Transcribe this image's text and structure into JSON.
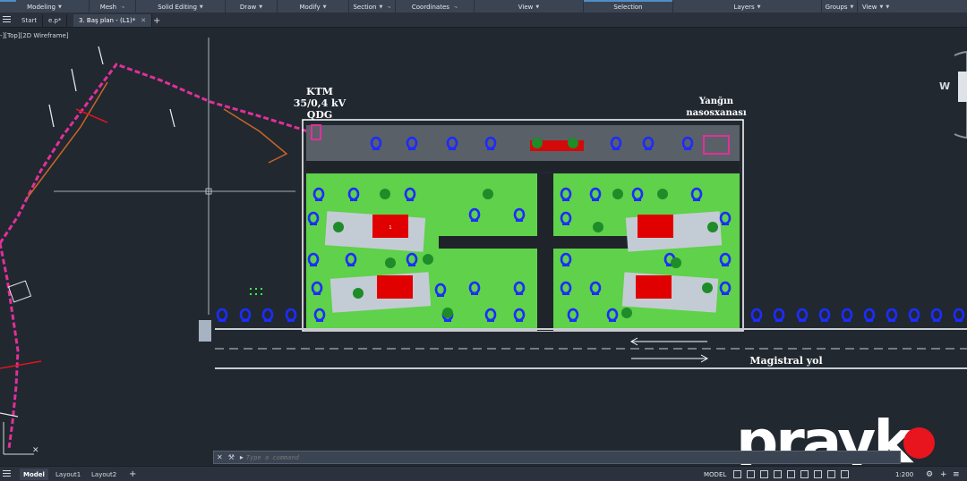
{
  "ribbon": {
    "panels": [
      "Modeling",
      "Mesh",
      "Solid Editing",
      "Draw",
      "Modify",
      "Section",
      "Coordinates",
      "View",
      "Selection",
      "Layers",
      "Groups",
      "View"
    ]
  },
  "tabs": {
    "start": "Start",
    "file1": "e.p*",
    "file2": "3. Baş plan - (L1)*",
    "new_tab": "+"
  },
  "viewport": {
    "label": "-][Top][2D Wireframe]"
  },
  "drawing": {
    "ktm_label_1": "KTM",
    "ktm_label_2": "35/0,4 kV",
    "ktm_label_3": "QDG",
    "pump_label_1": "Yanğın",
    "pump_label_2": "nasosxanası",
    "road_label": "Magistral yol",
    "building_number": "1",
    "viewcube_label": "W"
  },
  "command": {
    "placeholder": "Type a command"
  },
  "status": {
    "model_tab": "Model",
    "layout1": "Layout1",
    "layout2": "Layout2",
    "add": "+",
    "model_space": "MODEL",
    "scale": "1:200"
  },
  "watermark": {
    "text": "prayk"
  },
  "colors": {
    "ribbon_bg": "#3b4453",
    "canvas_bg": "#212830",
    "grass": "#5fd14a",
    "tree": "#1d2cff",
    "building": "#e10000",
    "path_magenta": "#e0309a",
    "watermark_dot": "#e8141e"
  }
}
